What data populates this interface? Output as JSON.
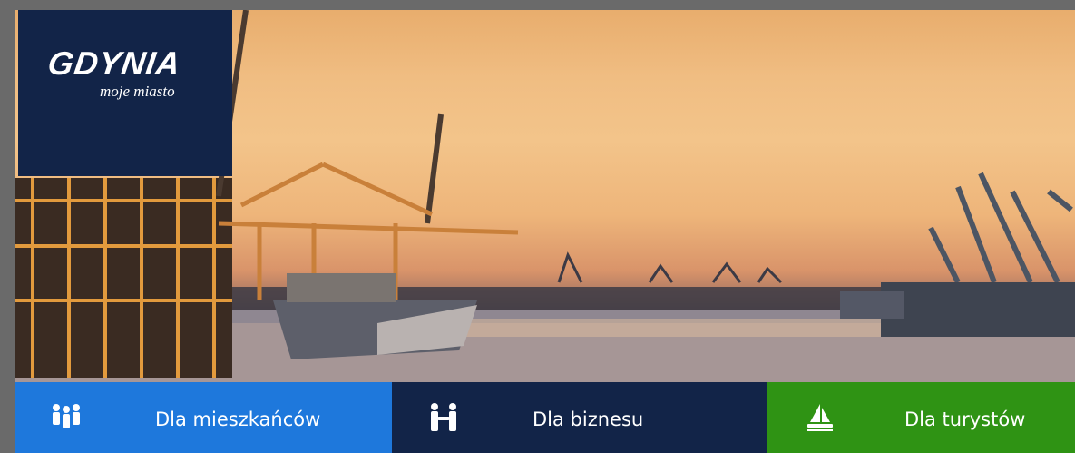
{
  "logo": {
    "title": "GDYNIA",
    "subtitle": "moje miasto"
  },
  "hero": {
    "description": "port-sunset-photo"
  },
  "nav": {
    "items": [
      {
        "label": "Dla mieszkańców",
        "icon": "people-icon",
        "color": "#1e78dc"
      },
      {
        "label": "Dla biznesu",
        "icon": "handshake-icon",
        "color": "#122448"
      },
      {
        "label": "Dla turystów",
        "icon": "sailboat-icon",
        "color": "#2f9314"
      }
    ]
  }
}
